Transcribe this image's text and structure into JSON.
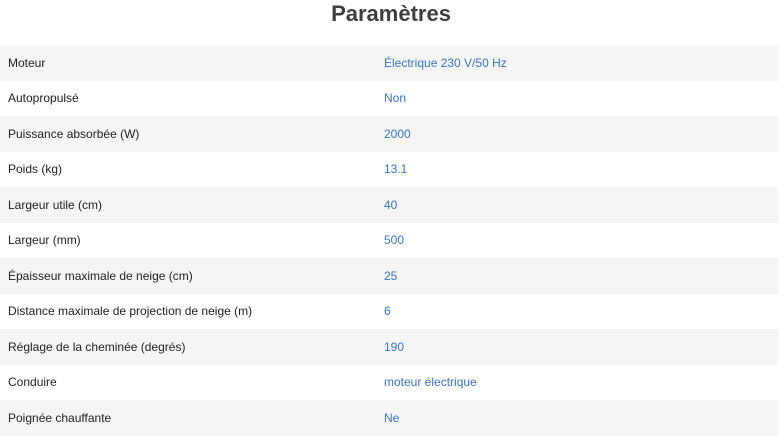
{
  "title": "Paramètres",
  "rows": [
    {
      "label": "Moteur",
      "value": "Électrique 230 V/50 Hz"
    },
    {
      "label": "Autopropulsé",
      "value": "Non"
    },
    {
      "label": "Puissance absorbée (W)",
      "value": "2000"
    },
    {
      "label": "Poids (kg)",
      "value": "13.1"
    },
    {
      "label": "Largeur utile (cm)",
      "value": "40"
    },
    {
      "label": "Largeur (mm)",
      "value": "500"
    },
    {
      "label": "Épaisseur maximale de neige (cm)",
      "value": "25"
    },
    {
      "label": "Distance maximale de projection de neige (m)",
      "value": "6"
    },
    {
      "label": "Réglage de la cheminée (degrés)",
      "value": "190"
    },
    {
      "label": "Conduire",
      "value": "moteur électrique"
    },
    {
      "label": "Poignée chauffante",
      "value": "Ne"
    }
  ]
}
